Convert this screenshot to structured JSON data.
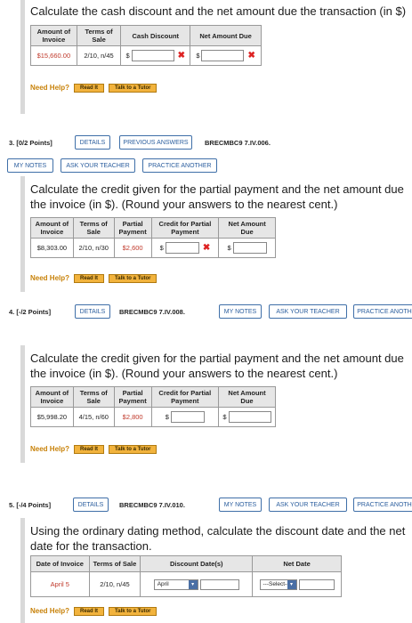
{
  "q_top": {
    "question": "Calculate the cash discount and the net amount due the transaction (in $)",
    "headers": [
      "Amount of Invoice",
      "Terms of Sale",
      "Cash Discount",
      "Net Amount Due"
    ],
    "amount": "$15,660.00",
    "terms": "2/10, n/45",
    "dollar": "$",
    "wrong": "✖"
  },
  "help": {
    "label": "Need Help?",
    "read": "Read It",
    "tutor": "Talk to a Tutor"
  },
  "q3": {
    "points": "3. [0/2 Points]",
    "details": "DETAILS",
    "previous": "PREVIOUS ANSWERS",
    "code": "BRECMBC9 7.IV.006.",
    "my_notes": "MY NOTES",
    "ask": "ASK YOUR TEACHER",
    "practice": "PRACTICE ANOTHER",
    "question": "Calculate the credit given for the partial payment and the net amount due the invoice (in $). (Round your answers to the nearest cent.)",
    "headers": [
      "Amount of Invoice",
      "Terms of Sale",
      "Partial Payment",
      "Credit for Partial Payment",
      "Net Amount Due"
    ],
    "amount": "$8,303.00",
    "terms": "2/10, n/30",
    "partial": "$2,600",
    "dollar": "$",
    "wrong": "✖"
  },
  "q4": {
    "points": "4. [-/2 Points]",
    "details": "DETAILS",
    "code": "BRECMBC9 7.IV.008.",
    "my_notes": "MY NOTES",
    "ask": "ASK YOUR TEACHER",
    "practice": "PRACTICE ANOTH",
    "question": "Calculate the credit given for the partial payment and the net amount due the invoice (in $). (Round your answers to the nearest cent.)",
    "headers": [
      "Amount of Invoice",
      "Terms of Sale",
      "Partial Payment",
      "Credit for Partial Payment",
      "Net Amount Due"
    ],
    "amount": "$5,998.20",
    "terms": "4/15, n/60",
    "partial": "$2,800",
    "dollar": "$"
  },
  "q5": {
    "points": "5. [-/4 Points]",
    "details": "DETAILS",
    "code": "BRECMBC9 7.IV.010.",
    "my_notes": "MY NOTES",
    "ask": "ASK YOUR TEACHER",
    "practice": "PRACTICE ANOTH",
    "question": "Using the ordinary dating method, calculate the discount date and the net date for the transaction.",
    "headers": [
      "Date of Invoice",
      "Terms of Sale",
      "Discount Date(s)",
      "Net Date"
    ],
    "date": "April 5",
    "terms": "2/10, n/45",
    "month_select": "April",
    "net_select": "---Select---",
    "arrow": "▾"
  }
}
